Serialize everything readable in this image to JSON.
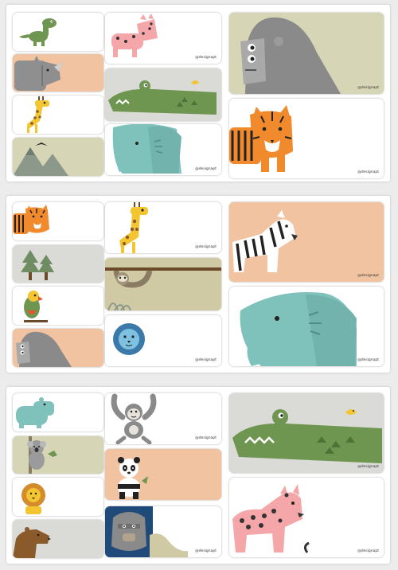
{
  "brand_label": "@designapt",
  "palette": {
    "peach": "#f1c3a0",
    "sage": "#d6d6b6",
    "grey_bg": "#dadad6",
    "khaki": "#cfc9a4",
    "navy": "#1f4a79",
    "gorilla": "#8a8a8a",
    "giraffe": "#f3c530",
    "tiger": "#f08a2c",
    "croc": "#6f9650",
    "elephant": "#7fc1bb",
    "leopard": "#f4a6a9"
  },
  "sheets": [
    {
      "name": "sheet-1",
      "labels": [
        "dinosaur",
        "rhino",
        "giraffe",
        "mountains-bird",
        "leopard",
        "crocodile",
        "elephant",
        "gorilla",
        "tiger"
      ]
    },
    {
      "name": "sheet-2",
      "labels": [
        "tiger",
        "trees",
        "parrot",
        "gorilla",
        "giraffe",
        "sloth",
        "blue-lion",
        "zebra",
        "elephant"
      ]
    },
    {
      "name": "sheet-3",
      "labels": [
        "hippo",
        "koala",
        "lion",
        "bear",
        "monkey",
        "panda",
        "baboon",
        "crocodile",
        "leopard"
      ]
    }
  ]
}
